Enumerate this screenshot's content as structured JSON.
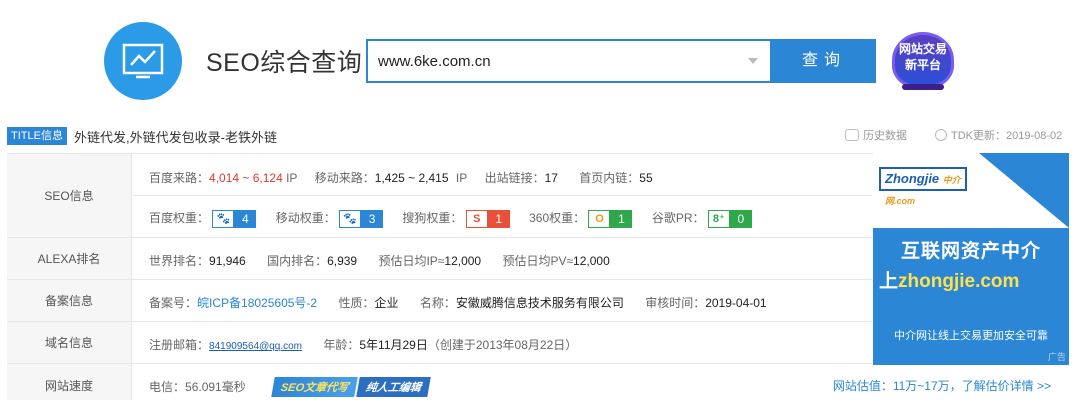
{
  "header": {
    "site_title": "SEO综合查询",
    "search_value": "www.6ke.com.cn",
    "search_button": "查询",
    "badge_line1": "网站交易",
    "badge_line2": "新平台"
  },
  "title_row": {
    "tag": "TITLE信息",
    "title": "外链代发,外链代发包收录-老铁外链",
    "history": "历史数据",
    "tdk": "TDK更新：2019-08-02"
  },
  "rows": {
    "seo": {
      "label": "SEO信息",
      "baidu_traffic_k": "百度来路：",
      "baidu_traffic_v": "4,014 ~ 6,124",
      "ip1": "IP",
      "mobile_traffic_k": "移动来路：",
      "mobile_traffic_v": "1,425 ~ 2,415",
      "ip2": "IP",
      "outlinks_k": "出站链接：",
      "outlinks_v": "17",
      "home_links_k": "首页内链：",
      "home_links_v": "55",
      "baidu_weight_k": "百度权重：",
      "baidu_weight_v": "4",
      "mobile_weight_k": "移动权重：",
      "mobile_weight_v": "3",
      "sogou_weight_k": "搜狗权重：",
      "sogou_weight_v": "1",
      "so360_weight_k": "360权重：",
      "so360_weight_v": "1",
      "google_pr_k": "谷歌PR：",
      "google_pr_v": "0"
    },
    "alexa": {
      "label": "ALEXA排名",
      "world_k": "世界排名：",
      "world_v": "91,946",
      "cn_k": "国内排名：",
      "cn_v": "6,939",
      "ip_k": "预估日均IP≈",
      "ip_v": "12,000",
      "pv_k": "预估日均PV≈",
      "pv_v": "12,000"
    },
    "icp": {
      "label": "备案信息",
      "no_k": "备案号：",
      "no_v": "皖ICP备18025605号-2",
      "nature_k": "性质：",
      "nature_v": "企业",
      "name_k": "名称：",
      "name_v": "安徽威腾信息技术服务有限公司",
      "date_k": "审核时间：",
      "date_v": "2019-04-01"
    },
    "domain": {
      "label": "域名信息",
      "email_k": "注册邮箱：",
      "email_v": "841909564@qq.com",
      "age_k": "年龄：",
      "age_v": "5年11月29日",
      "created": "（创建于2013年08月22日）"
    },
    "speed": {
      "label": "网站速度",
      "telecom_k": "电信：",
      "telecom_v": "56.091毫秒",
      "tag1": "SEO文章代写",
      "tag2": "纯人工编辑",
      "valuation": "网站估值：11万~17万，了解估价详情 >>"
    }
  },
  "ad": {
    "logo": "Zhongjie",
    "logo_suffix": "中介网.com",
    "line1": "互联网资产中介",
    "line2_prefix": "上",
    "line2_domain": "zhongjie.com",
    "footer": "中介网让线上交易更加安全可靠",
    "mark": "广告"
  },
  "colors": {
    "accent": "#2b86d6",
    "red": "#e23b2e",
    "baidu": "#2b86d6",
    "sogou": "#e8503a",
    "so360": "#2ea84a",
    "google": "#2ea84a"
  }
}
